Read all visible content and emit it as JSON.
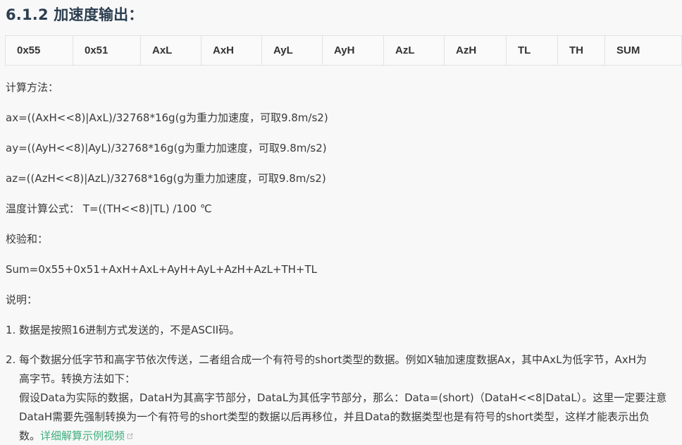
{
  "heading": "6.1.2 加速度输出：",
  "table": {
    "cells": [
      "0x55",
      "0x51",
      "AxL",
      "AxH",
      "AyL",
      "AyH",
      "AzL",
      "AzH",
      "TL",
      "TH",
      "SUM"
    ]
  },
  "calc_label": "计算方法：",
  "formulas": {
    "ax": "ax=((AxH<<8)|AxL)/32768*16g(g为重力加速度，可取9.8m/s2)",
    "ay": "ay=((AyH<<8)|AyL)/32768*16g(g为重力加速度，可取9.8m/s2)",
    "az": "az=((AzH<<8)|AzL)/32768*16g(g为重力加速度，可取9.8m/s2)"
  },
  "temp_formula": "温度计算公式： T=((TH<<8)|TL) /100 ℃",
  "checksum_label": "校验和：",
  "checksum_formula": "Sum=0x55+0x51+AxH+AxL+AyH+AyL+AzH+AzL+TH+TL",
  "notes_label": "说明：",
  "notes": {
    "item1_num": "1.",
    "item1_text": "数据是按照16进制方式发送的，不是ASCII码。",
    "item2_num": "2.",
    "item2_line1": "每个数据分低字节和高字节依次传送，二者组合成一个有符号的short类型的数据。例如X轴加速度数据Ax，其中AxL为低字节，AxH为",
    "item2_line2": "高字节。转换方法如下：",
    "item2_line3": "假设Data为实际的数据，DataH为其高字节部分，DataL为其低字节部分，那么：Data=(short)（DataH<<8|DataL）。这里一定要注意",
    "item2_line4": "DataH需要先强制转换为一个有符号的short类型的数据以后再移位，并且Data的数据类型也是有符号的short类型，这样才能表示出负",
    "item2_line5_prefix": "数。",
    "item2_link": "详细解算示例视频"
  },
  "colors": {
    "heading": "#2c3e50",
    "link": "#3eaf7c",
    "border": "#dfe2e5",
    "background": "#f8f8f8"
  },
  "icons": {
    "external_link": "external-link-icon"
  }
}
